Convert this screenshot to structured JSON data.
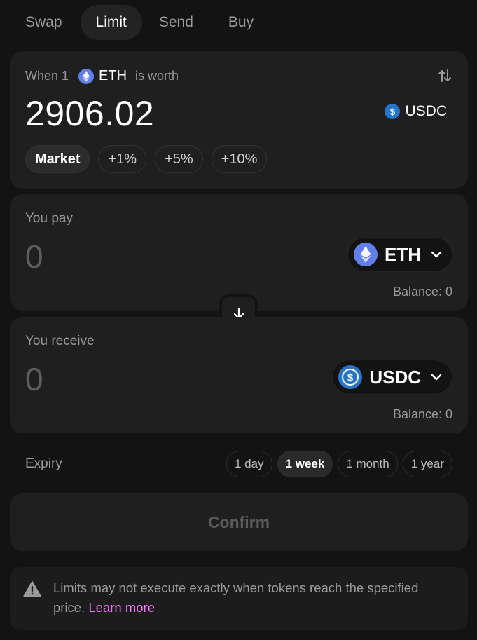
{
  "tabs": [
    {
      "label": "Swap",
      "active": false
    },
    {
      "label": "Limit",
      "active": true
    },
    {
      "label": "Send",
      "active": false
    },
    {
      "label": "Buy",
      "active": false
    }
  ],
  "limit": {
    "when_prefix": "When 1",
    "base_token": "ETH",
    "is_worth": "is worth",
    "price": "2906.02",
    "quote_token": "USDC",
    "presets": [
      {
        "label": "Market",
        "active": true
      },
      {
        "label": "+1%",
        "active": false
      },
      {
        "label": "+5%",
        "active": false
      },
      {
        "label": "+10%",
        "active": false
      }
    ]
  },
  "pay": {
    "label": "You pay",
    "amount": "0",
    "token": "ETH",
    "balance": "Balance: 0"
  },
  "receive": {
    "label": "You receive",
    "amount": "0",
    "token": "USDC",
    "balance": "Balance: 0"
  },
  "expiry": {
    "label": "Expiry",
    "options": [
      {
        "label": "1 day",
        "active": false
      },
      {
        "label": "1 week",
        "active": true
      },
      {
        "label": "1 month",
        "active": false
      },
      {
        "label": "1 year",
        "active": false
      }
    ]
  },
  "confirm_label": "Confirm",
  "notice": {
    "text": "Limits may not execute exactly when tokens reach the specified price.",
    "link": "Learn more"
  },
  "colors": {
    "background": "#131313",
    "card": "#1f1f1f",
    "accent_link": "#fc72ff",
    "eth": "#627eea",
    "usdc": "#2775ca"
  },
  "icons": [
    "eth-icon",
    "usdc-icon",
    "swap-vertical-icon",
    "chevron-down-icon",
    "arrow-down-icon",
    "warning-icon"
  ]
}
